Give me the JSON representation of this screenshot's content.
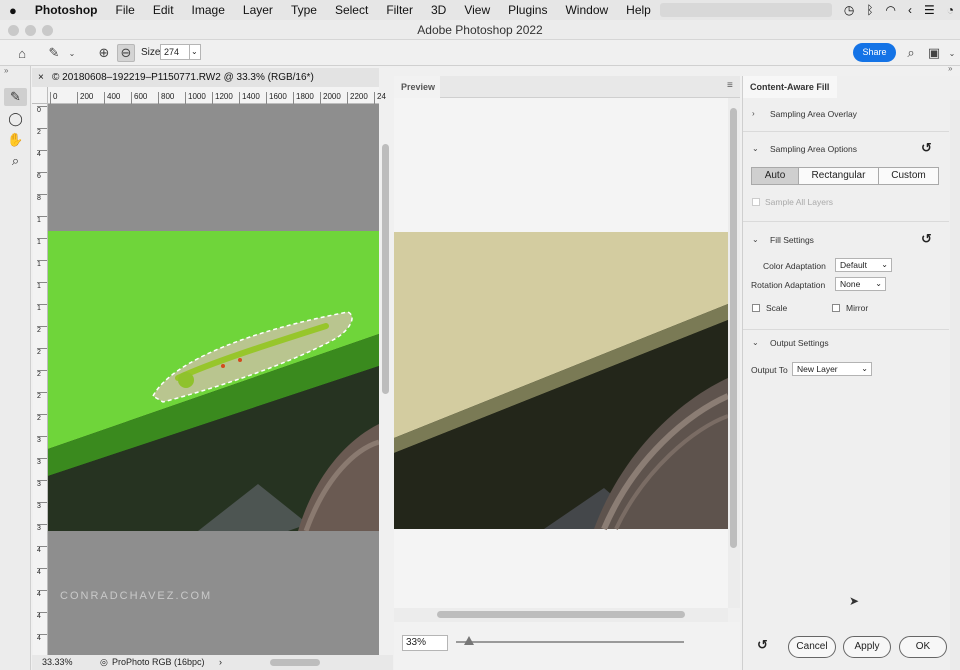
{
  "menubar": {
    "apple": "",
    "app": "Photoshop",
    "items": [
      "File",
      "Edit",
      "Image",
      "Layer",
      "Type",
      "Select",
      "Filter",
      "3D",
      "View",
      "Plugins",
      "Window",
      "Help"
    ]
  },
  "window": {
    "title": "Adobe Photoshop 2022"
  },
  "options": {
    "size_label": "Size",
    "size_value": "274",
    "share_label": "Share"
  },
  "document": {
    "tab_title": "© 20180608–192219–P1150771.RW2 @ 33.3% (RGB/16*)",
    "ruler_ticks": [
      "0",
      "200",
      "400",
      "600",
      "800",
      "1000",
      "1200",
      "1400",
      "1600",
      "1800",
      "2000",
      "2200",
      "24"
    ],
    "vruler_ticks": [
      "0",
      "2",
      "4",
      "6",
      "8",
      "1",
      "1",
      "1",
      "1",
      "1",
      "2",
      "2",
      "2",
      "2",
      "2",
      "3",
      "3",
      "3",
      "3",
      "3",
      "4",
      "4",
      "4",
      "4",
      "4"
    ],
    "watermark": "CONRADCHAVEZ.COM",
    "zoom": "33.33%",
    "profile": "ProPhoto RGB (16bpc)"
  },
  "preview": {
    "tab_label": "Preview",
    "zoom_value": "33%"
  },
  "panel": {
    "title": "Content-Aware Fill",
    "overlay_label": "Sampling Area Overlay",
    "options_label": "Sampling Area Options",
    "seg": [
      "Auto",
      "Rectangular",
      "Custom"
    ],
    "sample_all": "Sample All Layers",
    "fill_label": "Fill Settings",
    "color_adapt_label": "Color Adaptation",
    "color_adapt_value": "Default",
    "rotation_label": "Rotation Adaptation",
    "rotation_value": "None",
    "scale_label": "Scale",
    "mirror_label": "Mirror",
    "output_label": "Output Settings",
    "output_to_label": "Output To",
    "output_to_value": "New Layer",
    "cancel": "Cancel",
    "apply": "Apply",
    "ok": "OK"
  },
  "colors": {
    "accent": "#1473e6",
    "overlay_green": "#6fd53a"
  }
}
